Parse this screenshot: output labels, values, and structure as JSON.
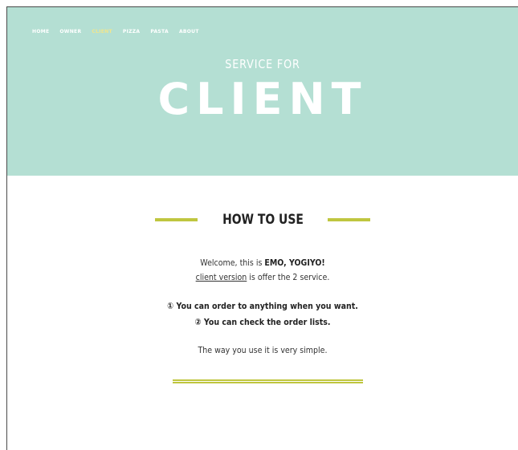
{
  "nav": {
    "items": [
      "HOME",
      "OWNER",
      "CLIENT",
      "PIZZA",
      "PASTA",
      "ABOUT"
    ],
    "active_index": 2,
    "active_color": "#f1e68c"
  },
  "hero": {
    "subtitle": "SERVICE FOR",
    "title": "CLIENT",
    "background_color": "#b4dfd3"
  },
  "how_to_use": {
    "heading": "HOW TO USE",
    "accent_color": "#bfc63f",
    "welcome_prefix": "Welcome, this is ",
    "brand_name": "EMO, YOGIYO!",
    "version_link": "client version",
    "service_text": " is offer the 2 service.",
    "services": [
      "① You can order to anything when you want.",
      "② You can check the order lists."
    ],
    "simple_note": "The way you use it is very simple."
  }
}
